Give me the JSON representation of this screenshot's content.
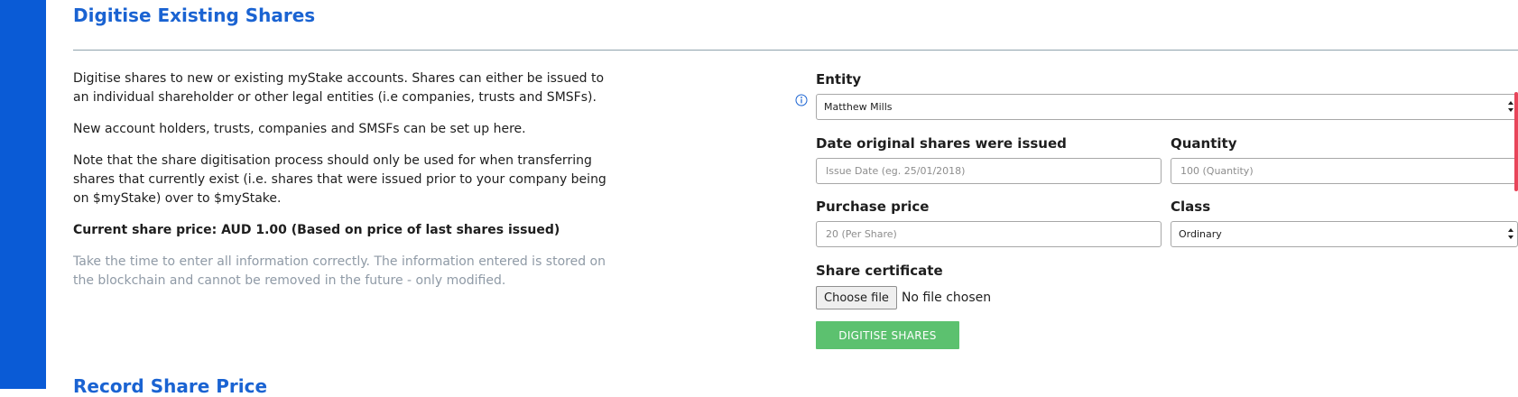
{
  "section": {
    "title": "Digitise Existing Shares",
    "next_title": "Record Share Price"
  },
  "intro": {
    "paragraph_1": "Digitise shares to new or existing myStake accounts. Shares can either be issued to an individual shareholder or other legal entities (i.e companies, trusts and SMSFs).",
    "paragraph_2": "New account holders, trusts, companies and SMSFs can be set up here.",
    "paragraph_3": "Note that the share digitisation process should only be used for when transferring shares that currently exist (i.e. shares that were issued prior to your company being on $myStake) over to $myStake.",
    "current_price": "Current share price: AUD 1.00 (Based on price of last shares issued)",
    "note": "Take the time to enter all information correctly. The information entered is stored on the blockchain and cannot be removed in the future - only modified."
  },
  "form": {
    "entity": {
      "label": "Entity",
      "value": "Matthew Mills"
    },
    "issue_date": {
      "label": "Date original shares were issued",
      "placeholder": "Issue Date (eg. 25/01/2018)",
      "value": ""
    },
    "quantity": {
      "label": "Quantity",
      "placeholder": "100 (Quantity)",
      "value": ""
    },
    "purchase_price": {
      "label": "Purchase price",
      "placeholder": "20 (Per Share)",
      "value": ""
    },
    "class": {
      "label": "Class",
      "value": "Ordinary"
    },
    "certificate": {
      "label": "Share certificate",
      "button_label": "Choose file",
      "status": "No file chosen"
    },
    "submit_label": "DIGITISE SHARES"
  },
  "icons": {
    "info": "info-circle-icon",
    "select_arrows": "select-updown-icon"
  },
  "colors": {
    "sidebar": "#0a5bd6",
    "title": "#1a63d2",
    "submit": "#5cc16f",
    "muted_text": "#8f9aa6",
    "scroll_marker": "#e8455a"
  }
}
